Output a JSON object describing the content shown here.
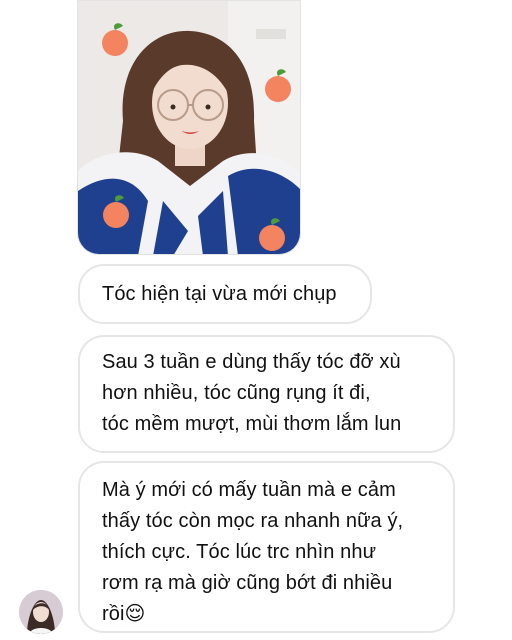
{
  "thread": {
    "photo": {
      "alt": "Ảnh chụp tóc hiện tại"
    },
    "messages": [
      {
        "lines": [
          "Tóc hiện tại vừa mới chụp"
        ]
      },
      {
        "lines": [
          "Sau 3 tuần e dùng thấy tóc đỡ xù",
          "hơn nhiều, tóc cũng rụng ít đi,",
          "tóc mềm mượt, mùi thơm lắm lun"
        ]
      },
      {
        "lines": [
          "Mà ý mới có mấy tuần mà e cảm",
          "thấy tóc còn mọc ra nhanh nữa ý,",
          "thích cực. Tóc lúc trc nhìn như",
          "rơm rạ mà giờ cũng bớt đi nhiều",
          "rồi😌"
        ]
      }
    ],
    "sender": {
      "avatar_icon": "user-avatar"
    }
  },
  "colors": {
    "bubble_border": "#e6e6e6",
    "text": "#111111",
    "peach": "#f4845f",
    "shirt_blue": "#1f3f8f"
  }
}
